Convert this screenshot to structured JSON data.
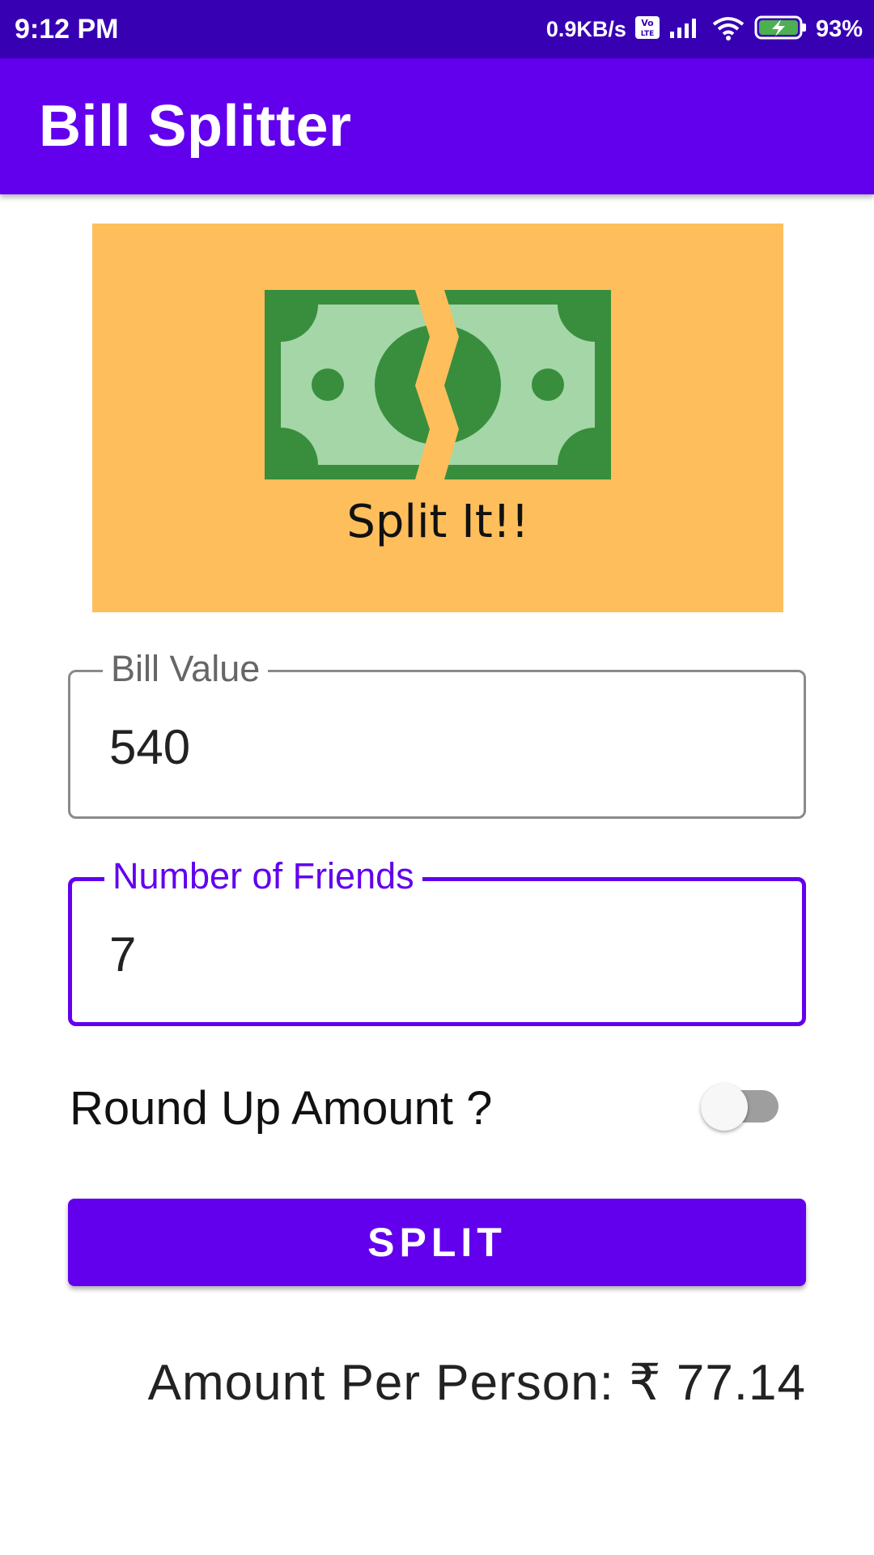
{
  "status_bar": {
    "time": "9:12 PM",
    "net_speed": "0.9KB/s",
    "volte": "Vo LTE",
    "battery_percent": "93%"
  },
  "app_bar": {
    "title": "Bill Splitter"
  },
  "hero": {
    "caption": "Split It!!",
    "icon": "split-money-icon"
  },
  "bill_field": {
    "label": "Bill Value",
    "value": "540"
  },
  "friends_field": {
    "label": "Number of Friends",
    "value": "7"
  },
  "round_up": {
    "label": "Round Up Amount ?",
    "checked": false
  },
  "split_button": {
    "label": "SPLIT"
  },
  "result": {
    "text": "Amount Per Person: ₹ 77.14"
  },
  "colors": {
    "primary": "#6200ee",
    "primary_dark": "#3700b3",
    "hero_bg": "#ffbe5c",
    "money_dark": "#388e3c",
    "money_light": "#a5d6a7"
  }
}
